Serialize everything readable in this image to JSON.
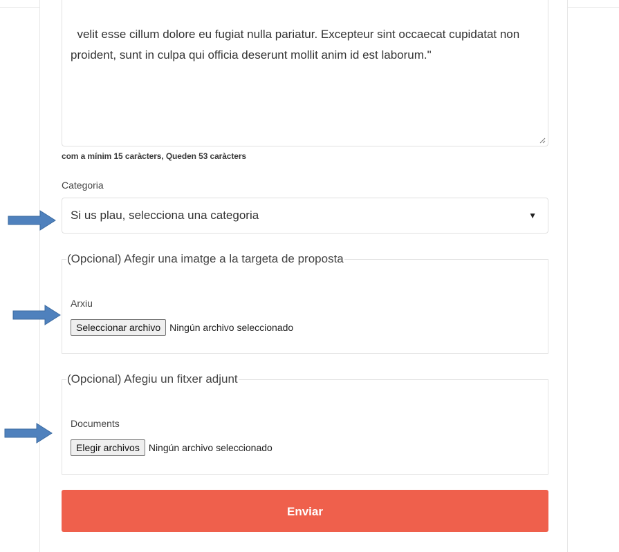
{
  "proposal_form": {
    "body_text": "velit esse cillum dolore eu fugiat nulla pariatur. Excepteur sint occaecat cupidatat non proident, sunt in culpa qui officia deserunt mollit anim id est laborum.\"",
    "char_hint": "com a mínim 15 caràcters, Queden 53 caràcters",
    "category": {
      "label": "Categoria",
      "selected": "Si us plau, selecciona una categoria",
      "caret": "▼"
    },
    "image_section": {
      "legend": "(Opcional) Afegir una imatge a la targeta de proposta",
      "field_label": "Arxiu",
      "button_label": "Seleccionar archivo",
      "status": "Ningún archivo seleccionado"
    },
    "attachment_section": {
      "legend": "(Opcional) Afegiu un fitxer adjunt",
      "field_label": "Documents",
      "button_label": "Elegir archivos",
      "status": "Ningún archivo seleccionado"
    },
    "submit_label": "Enviar"
  },
  "annotations": {
    "arrow_color": "#4f81bd",
    "arrow_icon": "right-arrow-icon"
  },
  "colors": {
    "submit_background": "#ef604c",
    "border": "#e0e0e0"
  }
}
